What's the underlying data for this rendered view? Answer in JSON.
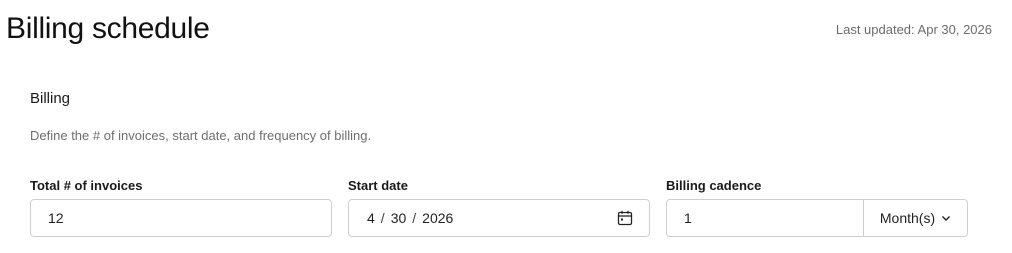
{
  "header": {
    "title": "Billing schedule",
    "last_updated": "Last updated: Apr 30, 2026"
  },
  "section": {
    "title": "Billing",
    "description": "Define the # of invoices, start date, and frequency of billing."
  },
  "fields": {
    "invoices": {
      "label": "Total # of invoices",
      "value": "12"
    },
    "start_date": {
      "label": "Start date",
      "month": "4",
      "day": "30",
      "year": "2026",
      "separator": "/",
      "icon": "calendar-icon"
    },
    "cadence": {
      "label": "Billing cadence",
      "value": "1",
      "unit": "Month(s)",
      "icon": "chevron-down-icon"
    }
  }
}
